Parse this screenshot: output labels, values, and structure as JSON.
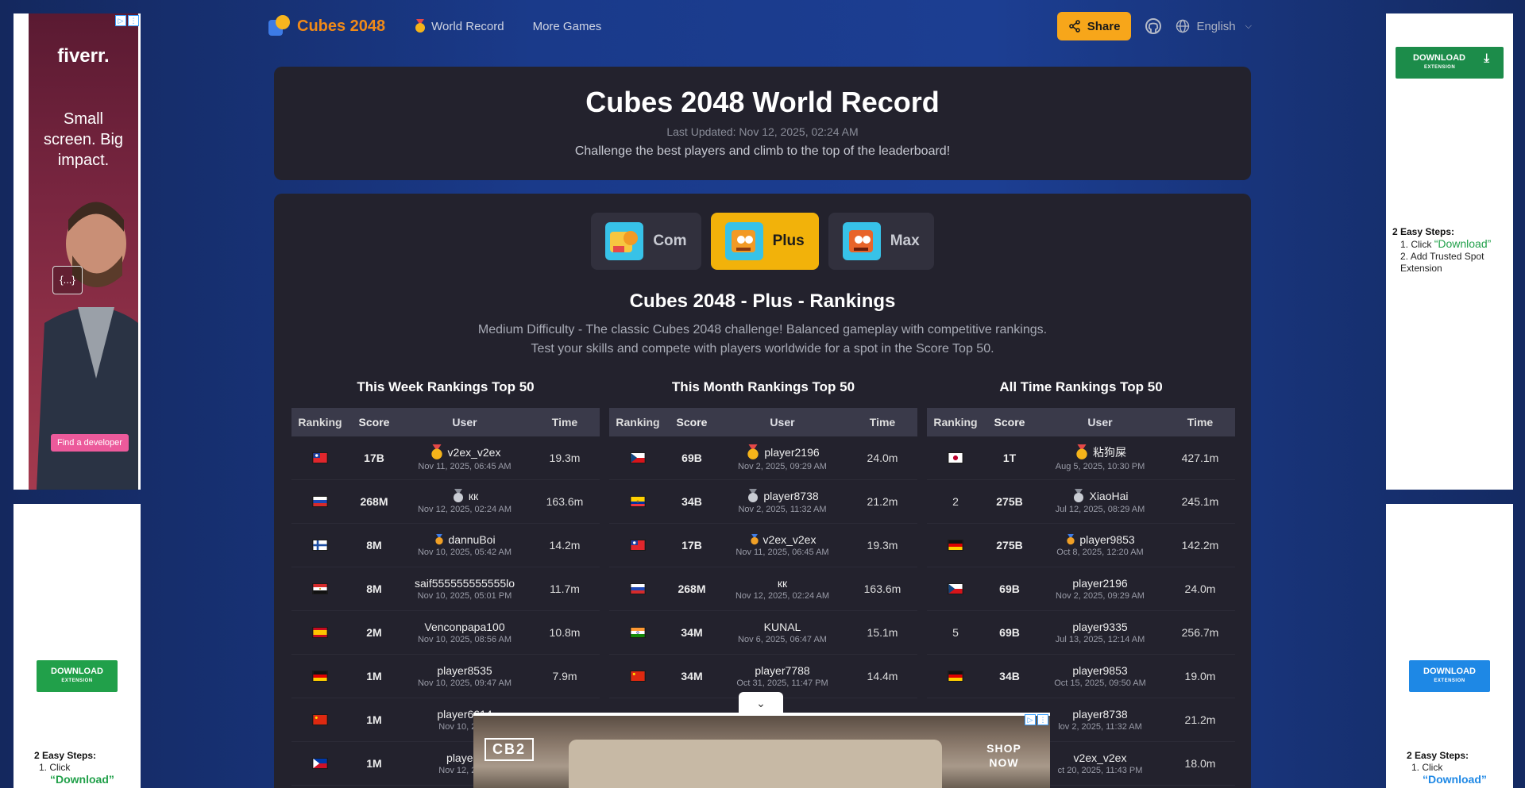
{
  "nav": {
    "brand": "Cubes 2048",
    "world_record": "World Record",
    "more_games": "More Games",
    "share": "Share",
    "language": "English"
  },
  "hero": {
    "title": "Cubes 2048 World Record",
    "updated": "Last Updated: Nov 12, 2025, 02:24 AM",
    "subtitle": "Challenge the best players and climb to the top of the leaderboard!"
  },
  "tabs": [
    {
      "label": "Com",
      "active": false
    },
    {
      "label": "Plus",
      "active": true
    },
    {
      "label": "Max",
      "active": false
    }
  ],
  "section": {
    "title": "Cubes 2048 - Plus - Rankings",
    "desc": "Medium Difficulty - The classic Cubes 2048 challenge! Balanced gameplay with competitive rankings. Test your skills and compete with players worldwide for a spot in the Score Top 50."
  },
  "columns": {
    "ranking": "Ranking",
    "score": "Score",
    "user": "User",
    "time": "Time"
  },
  "tables": [
    {
      "title": "This Week Rankings Top 50",
      "rows": [
        {
          "rank": "",
          "flag": "tw",
          "medal": "gold",
          "score": "17B",
          "user": "v2ex_v2ex",
          "date": "Nov 11, 2025, 06:45 AM",
          "time": "19.3m"
        },
        {
          "rank": "",
          "flag": "ru",
          "medal": "silver",
          "score": "268M",
          "user": "кк",
          "date": "Nov 12, 2025, 02:24 AM",
          "time": "163.6m"
        },
        {
          "rank": "",
          "flag": "fi",
          "medal": "bronze",
          "score": "8M",
          "user": "dannuBoi",
          "date": "Nov 10, 2025, 05:42 AM",
          "time": "14.2m"
        },
        {
          "rank": "",
          "flag": "eg",
          "medal": "",
          "score": "8M",
          "user": "saif555555555555lo",
          "date": "Nov 10, 2025, 05:01 PM",
          "time": "11.7m"
        },
        {
          "rank": "",
          "flag": "es",
          "medal": "",
          "score": "2M",
          "user": "Venconpapa100",
          "date": "Nov 10, 2025, 08:56 AM",
          "time": "10.8m"
        },
        {
          "rank": "",
          "flag": "de",
          "medal": "",
          "score": "1M",
          "user": "player8535",
          "date": "Nov 10, 2025, 09:47 AM",
          "time": "7.9m"
        },
        {
          "rank": "",
          "flag": "cn",
          "medal": "",
          "score": "1M",
          "user": "player6614",
          "date": "Nov 10, 2025",
          "time": ""
        },
        {
          "rank": "",
          "flag": "ph",
          "medal": "",
          "score": "1M",
          "user": "player4",
          "date": "Nov 12, 2025",
          "time": ""
        }
      ]
    },
    {
      "title": "This Month Rankings Top 50",
      "rows": [
        {
          "rank": "",
          "flag": "cz",
          "medal": "gold",
          "score": "69B",
          "user": "player2196",
          "date": "Nov 2, 2025, 09:29 AM",
          "time": "24.0m"
        },
        {
          "rank": "",
          "flag": "ec",
          "medal": "silver",
          "score": "34B",
          "user": "player8738",
          "date": "Nov 2, 2025, 11:32 AM",
          "time": "21.2m"
        },
        {
          "rank": "",
          "flag": "tw",
          "medal": "bronze",
          "score": "17B",
          "user": "v2ex_v2ex",
          "date": "Nov 11, 2025, 06:45 AM",
          "time": "19.3m"
        },
        {
          "rank": "",
          "flag": "ru",
          "medal": "",
          "score": "268M",
          "user": "кк",
          "date": "Nov 12, 2025, 02:24 AM",
          "time": "163.6m"
        },
        {
          "rank": "",
          "flag": "in",
          "medal": "",
          "score": "34M",
          "user": "KUNAL",
          "date": "Nov 6, 2025, 06:47 AM",
          "time": "15.1m"
        },
        {
          "rank": "",
          "flag": "cn",
          "medal": "",
          "score": "34M",
          "user": "player7788",
          "date": "Oct 31, 2025, 11:47 PM",
          "time": "14.4m"
        },
        {
          "rank": "",
          "flag": "",
          "medal": "",
          "score": "",
          "user": "",
          "date": "",
          "time": ""
        },
        {
          "rank": "",
          "flag": "",
          "medal": "",
          "score": "",
          "user": "",
          "date": "",
          "time": ""
        }
      ]
    },
    {
      "title": "All Time Rankings Top 50",
      "rows": [
        {
          "rank": "",
          "flag": "jp",
          "medal": "gold",
          "score": "1T",
          "user": "粘狗屎",
          "date": "Aug 5, 2025, 10:30 PM",
          "time": "427.1m"
        },
        {
          "rank": "2",
          "flag": "",
          "medal": "silver",
          "score": "275B",
          "user": "XiaoHai",
          "date": "Jul 12, 2025, 08:29 AM",
          "time": "245.1m"
        },
        {
          "rank": "",
          "flag": "de",
          "medal": "bronze",
          "score": "275B",
          "user": "player9853",
          "date": "Oct 8, 2025, 12:20 AM",
          "time": "142.2m"
        },
        {
          "rank": "",
          "flag": "cz",
          "medal": "",
          "score": "69B",
          "user": "player2196",
          "date": "Nov 2, 2025, 09:29 AM",
          "time": "24.0m"
        },
        {
          "rank": "5",
          "flag": "",
          "medal": "",
          "score": "69B",
          "user": "player9335",
          "date": "Jul 13, 2025, 12:14 AM",
          "time": "256.7m"
        },
        {
          "rank": "",
          "flag": "de",
          "medal": "",
          "score": "34B",
          "user": "player9853",
          "date": "Oct 15, 2025, 09:50 AM",
          "time": "19.0m"
        },
        {
          "rank": "",
          "flag": "",
          "medal": "",
          "score": "",
          "user": "player8738",
          "date": "lov 2, 2025, 11:32 AM",
          "time": "21.2m"
        },
        {
          "rank": "",
          "flag": "",
          "medal": "",
          "score": "",
          "user": "v2ex_v2ex",
          "date": "ct 20, 2025, 11:43 PM",
          "time": "18.0m"
        }
      ]
    }
  ],
  "ads": {
    "fiverr_logo": "fiverr.",
    "fiverr_slogan": "Small screen. Big impact.",
    "fiverr_code": "{...}",
    "fiverr_cta": "Find a developer",
    "download": "DOWNLOAD",
    "extension": "EXTENSION",
    "steps_title": "2 Easy Steps:",
    "step1": "Click",
    "step1_hl": "“Download”",
    "step2": "Add Trusted Spot Extension",
    "cb2": "CB2",
    "shop_now": "SHOP NOW"
  }
}
